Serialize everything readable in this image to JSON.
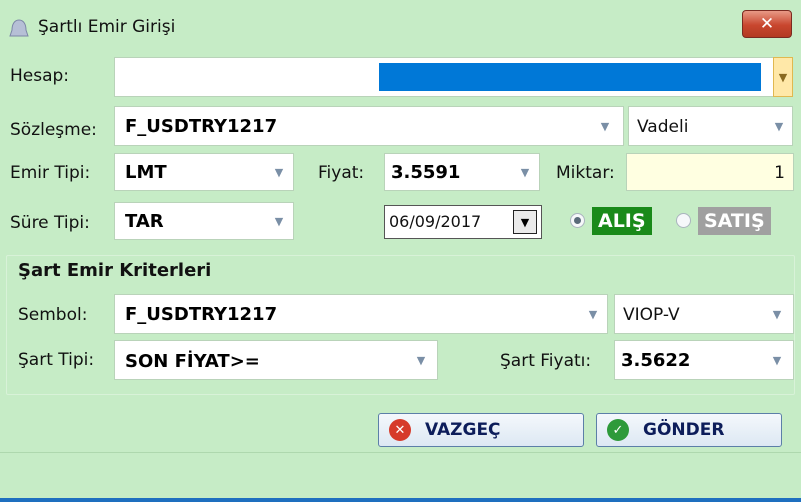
{
  "window": {
    "title": "Şartlı Emir Girişi",
    "close_glyph": "✕"
  },
  "form": {
    "hesap_label": "Hesap:",
    "sozlesme_label": "Sözleşme:",
    "sozlesme_value": "F_USDTRY1217",
    "sozlesme_type": "Vadeli",
    "emir_tipi_label": "Emir Tipi:",
    "emir_tipi_value": "LMT",
    "fiyat_label": "Fiyat:",
    "fiyat_value": "3.5591",
    "miktar_label": "Miktar:",
    "miktar_value": "1",
    "sure_tipi_label": "Süre Tipi:",
    "sure_tipi_value": "TAR",
    "date_value": "06/09/2017",
    "alis_label": "ALIŞ",
    "satis_label": "SATIŞ",
    "side_selected": "ALIŞ"
  },
  "criteria": {
    "title": "Şart Emir Kriterleri",
    "sembol_label": "Sembol:",
    "sembol_value": "F_USDTRY1217",
    "market_value": "VIOP-V",
    "sart_tipi_label": "Şart Tipi:",
    "sart_tipi_value": "SON FİYAT>=",
    "sart_fiyati_label": "Şart Fiyatı:",
    "sart_fiyati_value": "3.5622"
  },
  "buttons": {
    "cancel_label": "VAZGEÇ",
    "submit_label": "GÖNDER"
  },
  "colors": {
    "background": "#c6ecc6",
    "hesap_selection": "#0078d7",
    "alis_badge": "#1a8a1a",
    "satis_badge": "#a0a0a0",
    "miktar_bg": "#ffffe1"
  },
  "icons": [
    "app-bell-icon",
    "close-icon",
    "dropdown-arrow-icon",
    "cancel-x-icon",
    "check-icon"
  ]
}
